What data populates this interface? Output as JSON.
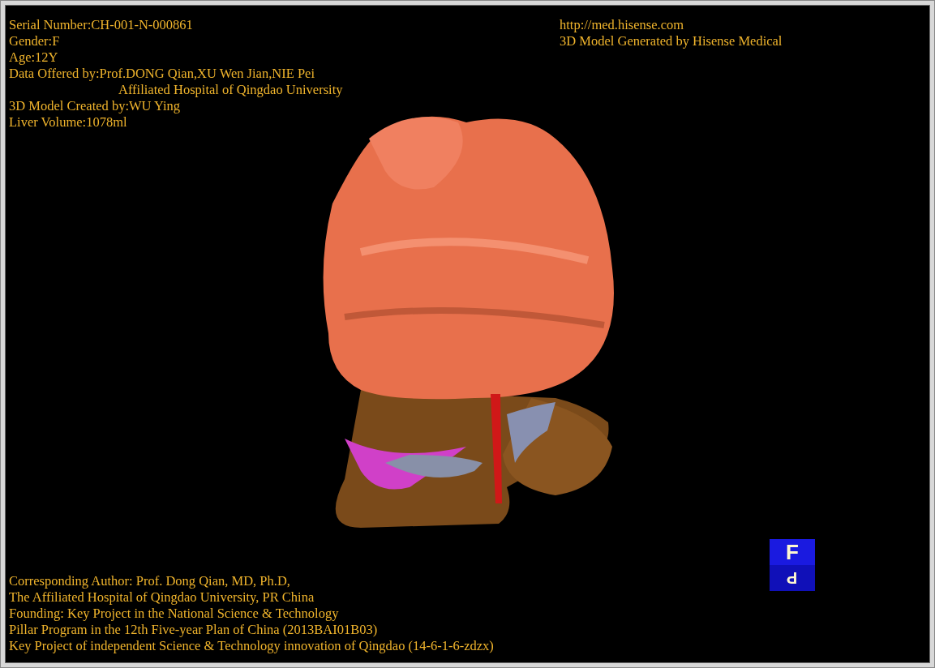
{
  "info_top_left": [
    {
      "kind": "line",
      "text": "Serial Number:CH-001-N-000861"
    },
    {
      "kind": "line",
      "text": "Gender:F"
    },
    {
      "kind": "line",
      "text": "Age:12Y"
    },
    {
      "kind": "line",
      "text": "Data Offered by:Prof.DONG Qian,XU Wen Jian,NIE Pei"
    },
    {
      "kind": "continuation",
      "text": "Affiliated Hospital of Qingdao University"
    },
    {
      "kind": "line",
      "text": "3D Model Created by:WU Ying"
    },
    {
      "kind": "line",
      "text": "Liver Volume:1078ml"
    }
  ],
  "info_top_right": [
    "http://med.hisense.com",
    "3D Model Generated by Hisense Medical"
  ],
  "info_bottom": [
    "Corresponding Author: Prof. Dong Qian, MD, Ph.D,",
    "The Affiliated Hospital of Qingdao University, PR China",
    "Founding: Key Project in the National Science & Technology",
    "Pillar Program in the 12th Five-year Plan of China (2013BAI01B03)",
    "Key Project of independent Science & Technology innovation of Qingdao (14-6-1-6-zdzx)"
  ],
  "orientation_cube": {
    "front": "F",
    "bottom": "P"
  }
}
